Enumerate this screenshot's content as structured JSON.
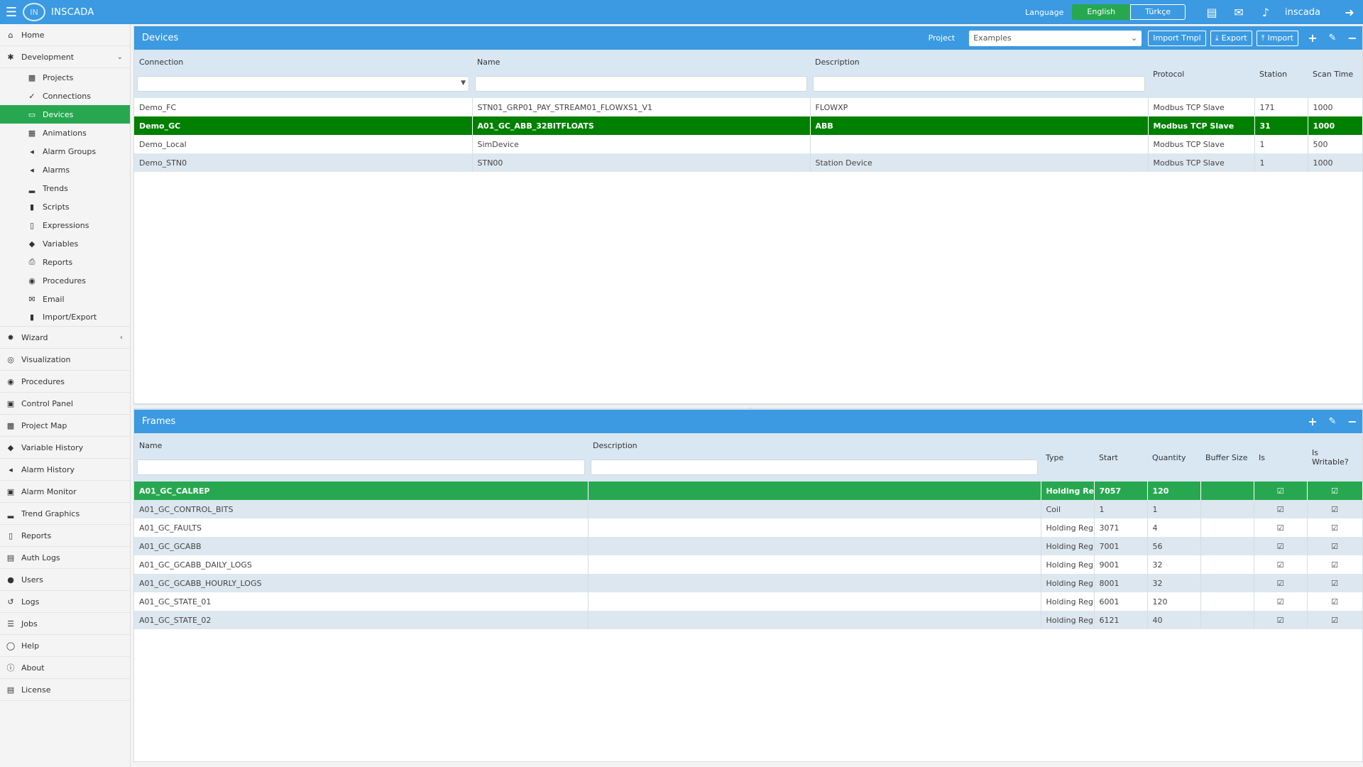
{
  "app": {
    "name": "INSCADA",
    "logo_text": "IN"
  },
  "topbar": {
    "language_label": "Language",
    "languages": [
      "English",
      "Türkçe"
    ],
    "active_language": "English",
    "user": "inscada"
  },
  "sidebar": {
    "items": [
      {
        "label": "Home",
        "icon": "home-icon"
      },
      {
        "label": "Development",
        "icon": "bug-icon",
        "expanded": true,
        "children": [
          {
            "label": "Projects",
            "icon": "briefcase-icon"
          },
          {
            "label": "Connections",
            "icon": "plug-icon"
          },
          {
            "label": "Devices",
            "icon": "monitor-icon",
            "active": true
          },
          {
            "label": "Animations",
            "icon": "film-icon"
          },
          {
            "label": "Alarm Groups",
            "icon": "bullhorn-icon"
          },
          {
            "label": "Alarms",
            "icon": "bullhorn-icon"
          },
          {
            "label": "Trends",
            "icon": "signal-icon"
          },
          {
            "label": "Scripts",
            "icon": "file-icon"
          },
          {
            "label": "Expressions",
            "icon": "file-code-icon"
          },
          {
            "label": "Variables",
            "icon": "tags-icon"
          },
          {
            "label": "Reports",
            "icon": "print-icon"
          },
          {
            "label": "Procedures",
            "icon": "dot-circle-icon"
          },
          {
            "label": "Email",
            "icon": "envelope-icon"
          },
          {
            "label": "Import/Export",
            "icon": "file-icon"
          }
        ]
      },
      {
        "label": "Wizard",
        "icon": "rebel-icon",
        "collapsed": true
      },
      {
        "label": "Visualization",
        "icon": "eye-icon"
      },
      {
        "label": "Procedures",
        "icon": "dot-circle-icon"
      },
      {
        "label": "Control Panel",
        "icon": "window-icon"
      },
      {
        "label": "Project Map",
        "icon": "map-icon"
      },
      {
        "label": "Variable History",
        "icon": "tags-icon"
      },
      {
        "label": "Alarm History",
        "icon": "bullhorn-icon"
      },
      {
        "label": "Alarm Monitor",
        "icon": "window-icon"
      },
      {
        "label": "Trend Graphics",
        "icon": "signal-icon"
      },
      {
        "label": "Reports",
        "icon": "file-icon"
      },
      {
        "label": "Auth Logs",
        "icon": "id-card-icon"
      },
      {
        "label": "Users",
        "icon": "user-icon"
      },
      {
        "label": "Logs",
        "icon": "history-icon"
      },
      {
        "label": "Jobs",
        "icon": "tasks-icon"
      },
      {
        "label": "Help",
        "icon": "life-ring-icon"
      },
      {
        "label": "About",
        "icon": "info-icon"
      },
      {
        "label": "License",
        "icon": "id-card-icon"
      }
    ]
  },
  "devices": {
    "title": "Devices",
    "project_label": "Project",
    "project_value": "Examples",
    "buttons": {
      "import_tmpl": "Import Tmpl",
      "export": "Export",
      "import": "Import"
    },
    "columns": [
      "Connection",
      "Name",
      "Description",
      "Protocol",
      "Station",
      "Scan Time"
    ],
    "rows": [
      [
        "Demo_FC",
        "STN01_GRP01_PAY_STREAM01_FLOWXS1_V1",
        "FLOWXP",
        "Modbus TCP Slave",
        "171",
        "1000"
      ],
      [
        "Demo_GC",
        "A01_GC_ABB_32BITFLOATS",
        "ABB",
        "Modbus TCP Slave",
        "31",
        "1000"
      ],
      [
        "Demo_Local",
        "SimDevice",
        "",
        "Modbus TCP Slave",
        "1",
        "500"
      ],
      [
        "Demo_STN0",
        "STN00",
        "Station Device",
        "Modbus TCP Slave",
        "1",
        "1000"
      ]
    ],
    "selected_row": 1
  },
  "frames": {
    "title": "Frames",
    "columns": [
      "Name",
      "Description",
      "Type",
      "Start",
      "Quantity",
      "Buffer Size",
      "Is",
      "Is Writable?"
    ],
    "rows": [
      [
        "A01_GC_CALREP",
        "",
        "Holding Regis",
        "7057",
        "120",
        ""
      ],
      [
        "A01_GC_CONTROL_BITS",
        "",
        "Coil",
        "1",
        "1",
        ""
      ],
      [
        "A01_GC_FAULTS",
        "",
        "Holding Regis",
        "3071",
        "4",
        ""
      ],
      [
        "A01_GC_GCABB",
        "",
        "Holding Regis",
        "7001",
        "56",
        ""
      ],
      [
        "A01_GC_GCABB_DAILY_LOGS",
        "",
        "Holding Regis",
        "9001",
        "32",
        ""
      ],
      [
        "A01_GC_GCABB_HOURLY_LOGS",
        "",
        "Holding Regis",
        "8001",
        "32",
        ""
      ],
      [
        "A01_GC_STATE_01",
        "",
        "Holding Regis",
        "6001",
        "120",
        ""
      ],
      [
        "A01_GC_STATE_02",
        "",
        "Holding Regis",
        "6121",
        "40",
        ""
      ]
    ],
    "selected_row": 0
  },
  "colors": {
    "header_blue": "#3b9ae1",
    "accent_green": "#27a850",
    "selected_green": "#008000"
  }
}
